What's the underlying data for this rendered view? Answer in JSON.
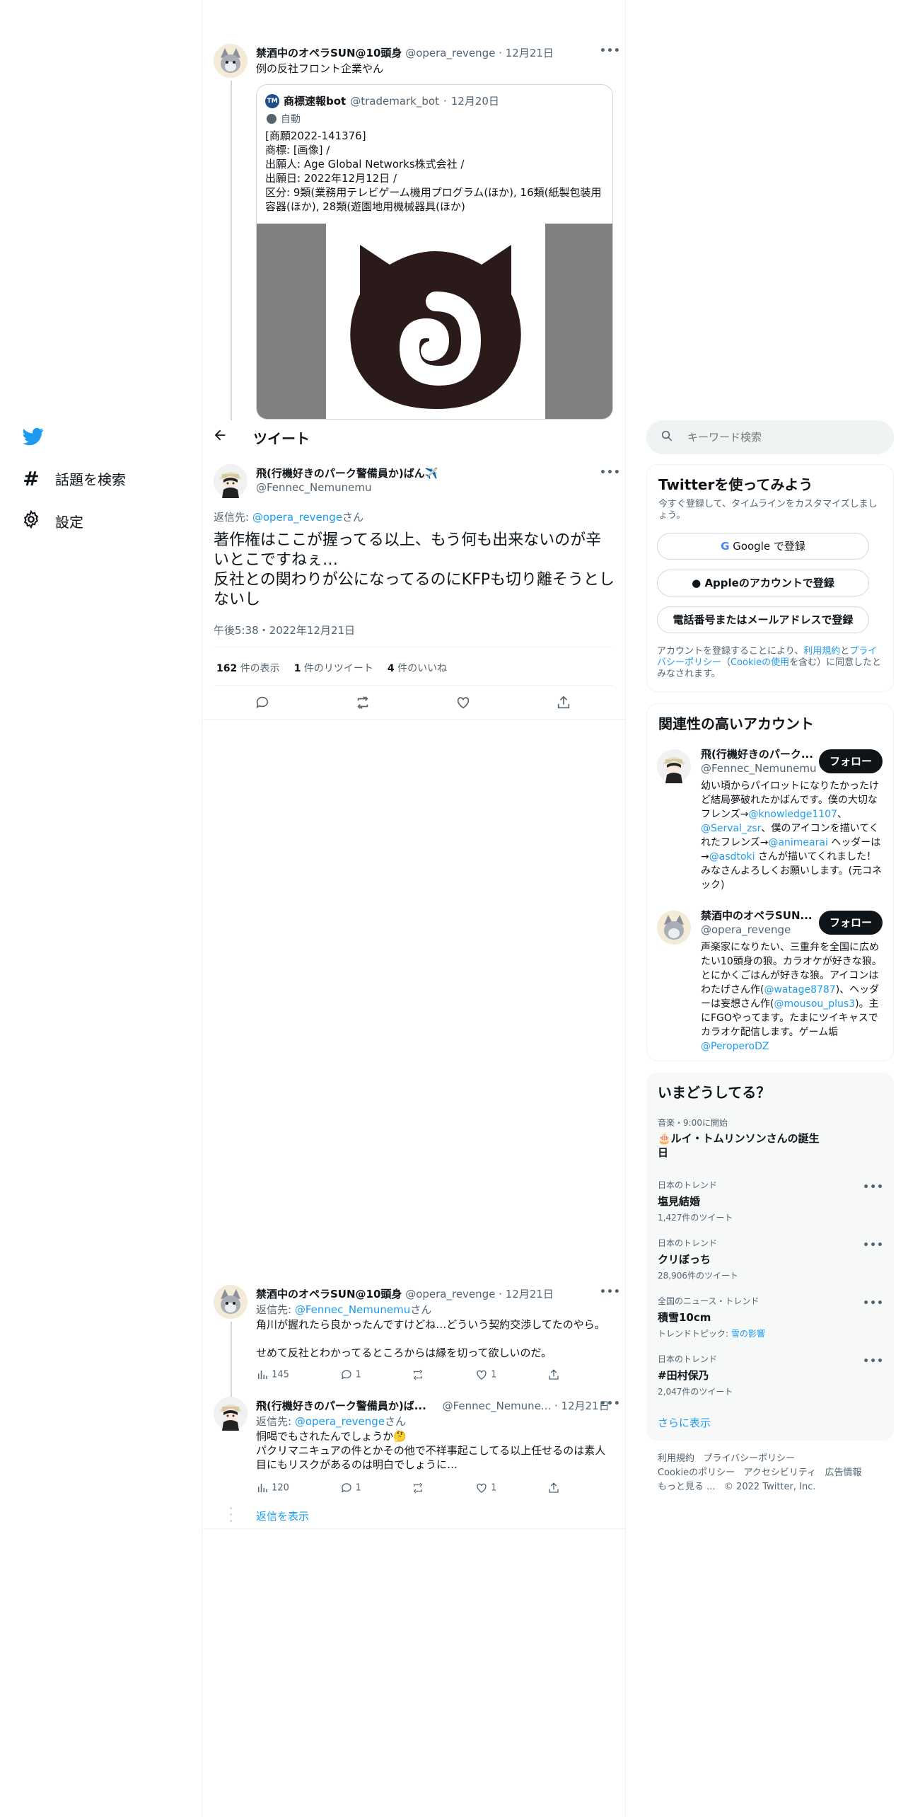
{
  "nav": {
    "explore_label": "話題を検索",
    "settings_label": "設定"
  },
  "search": {
    "placeholder": "キーワード検索"
  },
  "header": {
    "title": "ツイート"
  },
  "parent_tweet": {
    "name": "禁酒中のオペラSUN@10頭身",
    "handle": "@opera_revenge",
    "date": "12月21日",
    "text": "例の反社フロント企業やん",
    "quote": {
      "badge": "TM",
      "name": "商標速報bot",
      "handle": "@trademark_bot",
      "date": "12月20日",
      "auto_label": "自動",
      "lines": [
        "[商願2022-141376]",
        "商標: [画像] /",
        "出願人: Age Global Networks株式会社 /",
        "出願日: 2022年12月12日 /",
        "区分: 9類(業務用テレビゲーム機用プログラム(ほか), 16類(紙製包装用容器(ほか), 28類(遊園地用機械器具(ほか)"
      ]
    }
  },
  "main_tweet": {
    "name": "飛(行機好きのパーク警備員か)ばん✈️",
    "handle": "@Fennec_Nemunemu",
    "reply_prefix": "返信先: ",
    "reply_to": "@opera_revenge",
    "reply_suffix": "さん",
    "text_line1": "著作権はここが握ってる以上、もう何も出来ないのが辛いとこですねぇ…",
    "text_line2": "反社との関わりが公になってるのにKFPも切り離そうとしないし",
    "timestamp": "午後5:38・2022年12月21日",
    "views": "162",
    "views_label": "件の表示",
    "retweets": "1",
    "retweets_label": "件のリツイート",
    "likes": "4",
    "likes_label": "件のいいね"
  },
  "replies": [
    {
      "name": "禁酒中のオペラSUN@10頭身",
      "handle": "@opera_revenge",
      "date": "12月21日",
      "reply_prefix": "返信先: ",
      "reply_to": "@Fennec_Nemunemu",
      "reply_suffix": "さん",
      "line1": "角川が握れたら良かったんですけどね…どういう契約交渉してたのやら。",
      "line2": "せめて反社とわかってるところからは縁を切って欲しいのだ。",
      "views": "145",
      "replies": "1",
      "likes": "1"
    },
    {
      "name": "飛(行機好きのパーク警備員か)ば...",
      "handle": "@Fennec_Nemune...",
      "date": "12月21日",
      "reply_prefix": "返信先: ",
      "reply_to": "@opera_revenge",
      "reply_suffix": "さん",
      "line1": "恫喝でもされたんでしょうか🤔",
      "line2": "パクリマニキュアの件とかその他で不祥事起こしてる以上任せるのは素人目にもリスクがあるのは明白でしょうに…",
      "views": "120",
      "replies": "1",
      "likes": "1"
    }
  ],
  "show_replies": "返信を表示",
  "signup": {
    "title": "Twitterを使ってみよう",
    "subtitle": "今すぐ登録して、タイムラインをカスタマイズしましょう。",
    "google": "Google で登録",
    "apple": "Appleのアカウントで登録",
    "phone": "電話番号またはメールアドレスで登録",
    "legal_a": "アカウントを登録することにより、",
    "legal_terms": "利用規約",
    "legal_b": "と",
    "legal_privacy": "プライバシーポリシー",
    "legal_c": "（",
    "legal_cookie": "Cookieの使用",
    "legal_d": "を含む）に同意したとみなされます。"
  },
  "related": {
    "title": "関連性の高いアカウント",
    "follow_label": "フォロー",
    "accounts": [
      {
        "name": "飛(行機好きのパーク...",
        "handle": "@Fennec_Nemunemu",
        "bio_a": "幼い頃からパイロットになりたかったけど結局夢破れたかばんです。僕の大切なフレンズ→",
        "bio_link1": "@knowledge1107",
        "bio_b": "、",
        "bio_link2": "@Serval_zsr",
        "bio_c": "、僕のアイコンを描いてくれたフレンズ→",
        "bio_link3": "@animearai",
        "bio_d": " ヘッダーは→",
        "bio_link4": "@asdtoki",
        "bio_e": " さんが描いてくれました！みなさんよろしくお願いします。(元コネック)"
      },
      {
        "name": "禁酒中のオペラSUN...",
        "handle": "@opera_revenge",
        "bio_a": "声楽家になりたい、三重弁を全国に広めたい10頭身の狼。カラオケが好きな狼。とにかくごはんが好きな狼。アイコンはわたげさん作(",
        "bio_link1": "@watage8787",
        "bio_b": ")、ヘッダーは妄想さん作(",
        "bio_link2": "@mousou_plus3",
        "bio_c": ")。主にFGOやってます。たまにツイキャスでカラオケ配信します。ゲーム垢",
        "bio_link3": "@PeroperoDZ",
        "bio_d": "",
        "bio_link4": "",
        "bio_e": ""
      }
    ]
  },
  "trends": {
    "title": "いまどうしてる？",
    "items": [
      {
        "context": "音楽・9:00に開始",
        "name": "🎂ルイ・トムリンソンさんの誕生日",
        "meta": "",
        "more": false
      },
      {
        "context": "日本のトレンド",
        "name": "塩見結婚",
        "meta": "1,427件のツイート",
        "more": true
      },
      {
        "context": "日本のトレンド",
        "name": "クリぼっち",
        "meta": "28,906件のツイート",
        "more": true
      },
      {
        "context": "全国のニュース・トレンド",
        "name": "積雪10cm",
        "meta_prefix": "トレンドトピック: ",
        "meta_link": "雪の影響",
        "meta": "",
        "more": true
      },
      {
        "context": "日本のトレンド",
        "name": "#田村保乃",
        "meta": "2,047件のツイート",
        "more": true
      }
    ],
    "show_more": "さらに表示"
  },
  "footer": {
    "terms": "利用規約",
    "privacy": "プライバシーポリシー",
    "cookie": "Cookieのポリシー",
    "accessibility": "アクセシビリティ",
    "ads": "広告情報",
    "more": "もっと見る ...",
    "copyright": "© 2022 Twitter, Inc."
  },
  "colors": {
    "accent": "#1d9bf0",
    "text": "#0f1419",
    "secondary": "#536471",
    "border": "#eff3f4"
  }
}
